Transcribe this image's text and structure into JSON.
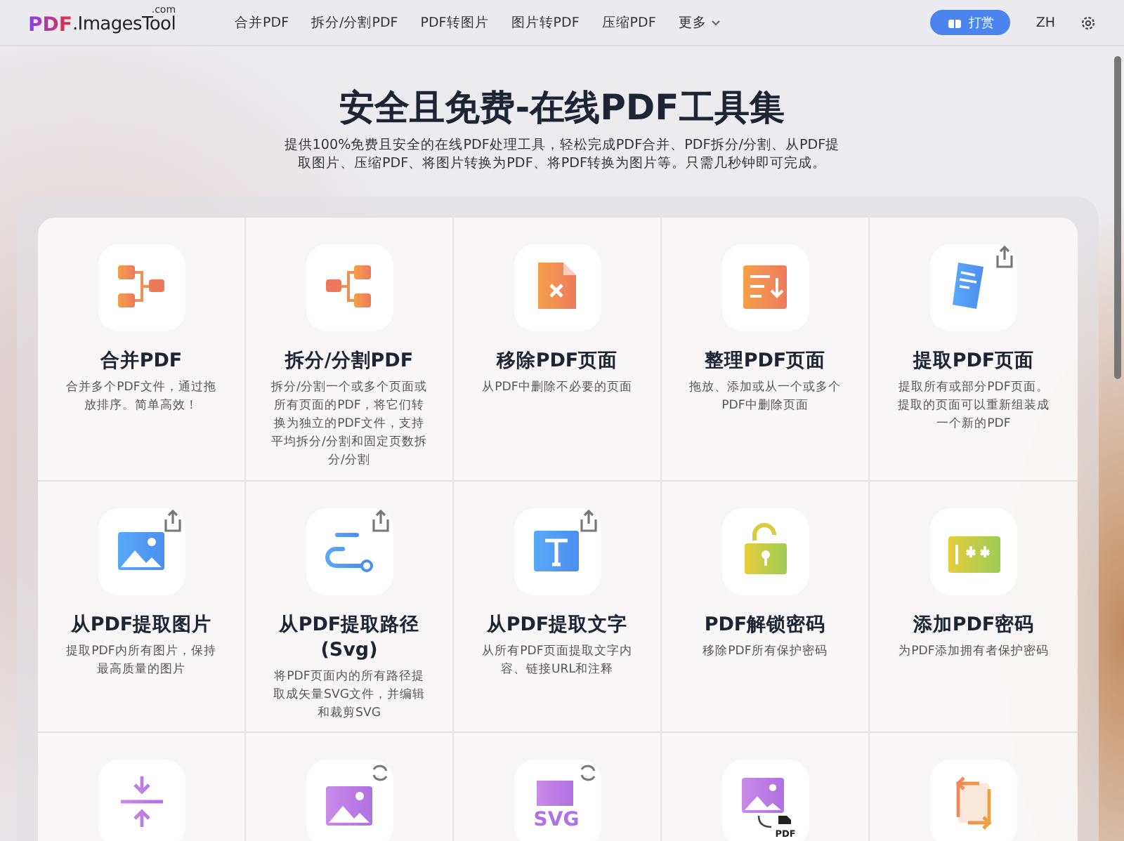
{
  "nav": {
    "logo": {
      "main": "PDF",
      "rest": ".ImagesTool",
      "suffix": ".com"
    },
    "links": [
      {
        "label": "合并PDF"
      },
      {
        "label": "拆分/分割PDF"
      },
      {
        "label": "PDF转图片"
      },
      {
        "label": "图片转PDF"
      },
      {
        "label": "压缩PDF"
      },
      {
        "label": "更多",
        "dropdown": true
      }
    ],
    "donate_button": "打赏",
    "language": "ZH"
  },
  "hero": {
    "title": "安全且免费-在线PDF工具集",
    "subtitle": "提供100%免费且安全的在线PDF处理工具，轻松完成PDF合并、PDF拆分/分割、从PDF提取图片、压缩PDF、将图片转换为PDF、将PDF转换为图片等。只需几秒钟即可完成。"
  },
  "tools": [
    {
      "kind": "merge",
      "title": "合并PDF",
      "description": "合并多个PDF文件，通过拖放排序。简单高效！"
    },
    {
      "kind": "split",
      "title": "拆分/分割PDF",
      "description": "拆分/分割一个或多个页面或所有页面的PDF，将它们转换为独立的PDF文件，支持平均拆分/分割和固定页数拆分/分割"
    },
    {
      "kind": "remove",
      "title": "移除PDF页面",
      "description": "从PDF中删除不必要的页面"
    },
    {
      "kind": "organize",
      "title": "整理PDF页面",
      "description": "拖放、添加或从一个或多个PDF中删除页面"
    },
    {
      "kind": "extract-pages",
      "title": "提取PDF页面",
      "description": "提取所有或部分PDF页面。提取的页面可以重新组装成一个新的PDF"
    },
    {
      "kind": "extract-images",
      "title": "从PDF提取图片",
      "description": "提取PDF内所有图片，保持最高质量的图片"
    },
    {
      "kind": "extract-path",
      "title": "从PDF提取路径(Svg)",
      "description": "将PDF页面内的所有路径提取成矢量SVG文件，并编辑和裁剪SVG"
    },
    {
      "kind": "extract-text",
      "title": "从PDF提取文字",
      "description": "从所有PDF页面提取文字内容、链接URL和注释"
    },
    {
      "kind": "unlock",
      "title": "PDF解锁密码",
      "description": "移除PDF所有保护密码"
    },
    {
      "kind": "protect",
      "title": "添加PDF密码",
      "description": "为PDF添加拥有者保护密码"
    },
    {
      "kind": "compress"
    },
    {
      "kind": "image-convert"
    },
    {
      "kind": "svg-convert",
      "icon_text": "SVG"
    },
    {
      "kind": "image-to-pdf",
      "icon_text": "PDF"
    },
    {
      "kind": "rotate"
    }
  ]
}
